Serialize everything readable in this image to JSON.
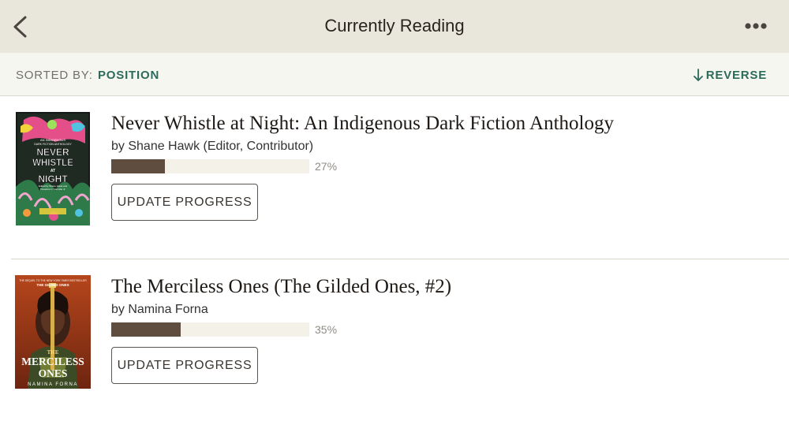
{
  "header": {
    "title": "Currently Reading"
  },
  "sortbar": {
    "label": "SORTED BY:",
    "value": "POSITION",
    "reverse_label": "REVERSE"
  },
  "books": [
    {
      "title": "Never Whistle at Night: An Indigenous Dark Fiction Anthology",
      "author": "by Shane Hawk (Editor, Contributor)",
      "progress": 27,
      "progress_label": "27%",
      "button_label": "UPDATE PROGRESS",
      "cover_text": [
        "AN INDIGENOUS",
        "DARK FICTION ANTHOLOGY",
        "NEVER",
        "WHISTLE",
        "AT",
        "NIGHT",
        "Edited by Shane Hawk and",
        "Theodore C. Van Alst Jr."
      ]
    },
    {
      "title": "The Merciless Ones (The Gilded Ones, #2)",
      "author": "by Namina Forna",
      "progress": 35,
      "progress_label": "35%",
      "button_label": "UPDATE PROGRESS",
      "cover_text": [
        "THE SEQUEL TO THE NEW YORK TIMES BESTSELLER",
        "THE GILDED ONES",
        "THE",
        "MERCILESS",
        "ONES",
        "NAMINA FORNA"
      ]
    }
  ]
}
